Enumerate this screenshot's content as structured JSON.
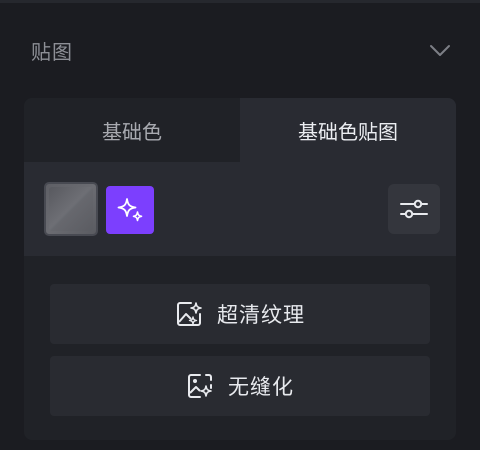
{
  "section": {
    "title": "贴图"
  },
  "tabs": [
    {
      "label": "基础色",
      "active": false
    },
    {
      "label": "基础色贴图",
      "active": true
    }
  ],
  "swatch": {
    "color": "#636469"
  },
  "colors": {
    "accent": "#7c3ffe",
    "background": "#1b1c21",
    "panel": "#202227",
    "panel_active": "#292b32"
  },
  "icons": {
    "collapse": "chevron-down-icon",
    "ai": "sparkle-icon",
    "settings": "sliders-icon",
    "hd_texture": "image-sparkle-icon",
    "seamless": "image-tile-icon"
  },
  "actions": {
    "hd_texture_label": "超清纹理",
    "seamless_label": "无缝化"
  }
}
